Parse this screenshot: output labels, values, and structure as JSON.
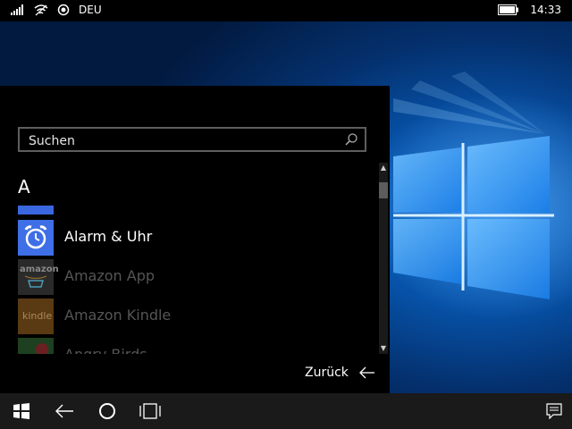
{
  "status_bar": {
    "language": "DEU",
    "time": "14:33",
    "signal_icon": "signal-bars-icon",
    "wifi_icon": "wifi-icon",
    "location_icon": "location-icon",
    "battery_icon": "battery-icon"
  },
  "start_panel": {
    "search": {
      "placeholder": "Suchen",
      "value": ""
    },
    "section_letter": "A",
    "apps": [
      {
        "label": "",
        "tile_color": "#3a66e0",
        "state": "partial"
      },
      {
        "label": "Alarm & Uhr",
        "tile_color": "#3f6fe6",
        "state": "active",
        "icon": "alarm-clock-icon"
      },
      {
        "label": "Amazon App",
        "tile_color": "#222222",
        "state": "dim",
        "icon_text": "amazon"
      },
      {
        "label": "Amazon Kindle",
        "tile_color": "#5a3a12",
        "state": "dim",
        "icon_text": "kindle"
      },
      {
        "label": "Angry Birds",
        "tile_color": "#1e4020",
        "state": "partial"
      }
    ],
    "back_label": "Zurück"
  },
  "nav_bar": {
    "start_icon": "windows-logo-icon",
    "back_icon": "back-arrow-icon",
    "search_icon": "cortana-circle-icon",
    "task_view_icon": "task-view-icon",
    "notifications_icon": "action-center-icon"
  },
  "colors": {
    "accent": "#3f6fe6",
    "panel_bg": "#000000",
    "navbar_bg": "#1a1a1a"
  }
}
